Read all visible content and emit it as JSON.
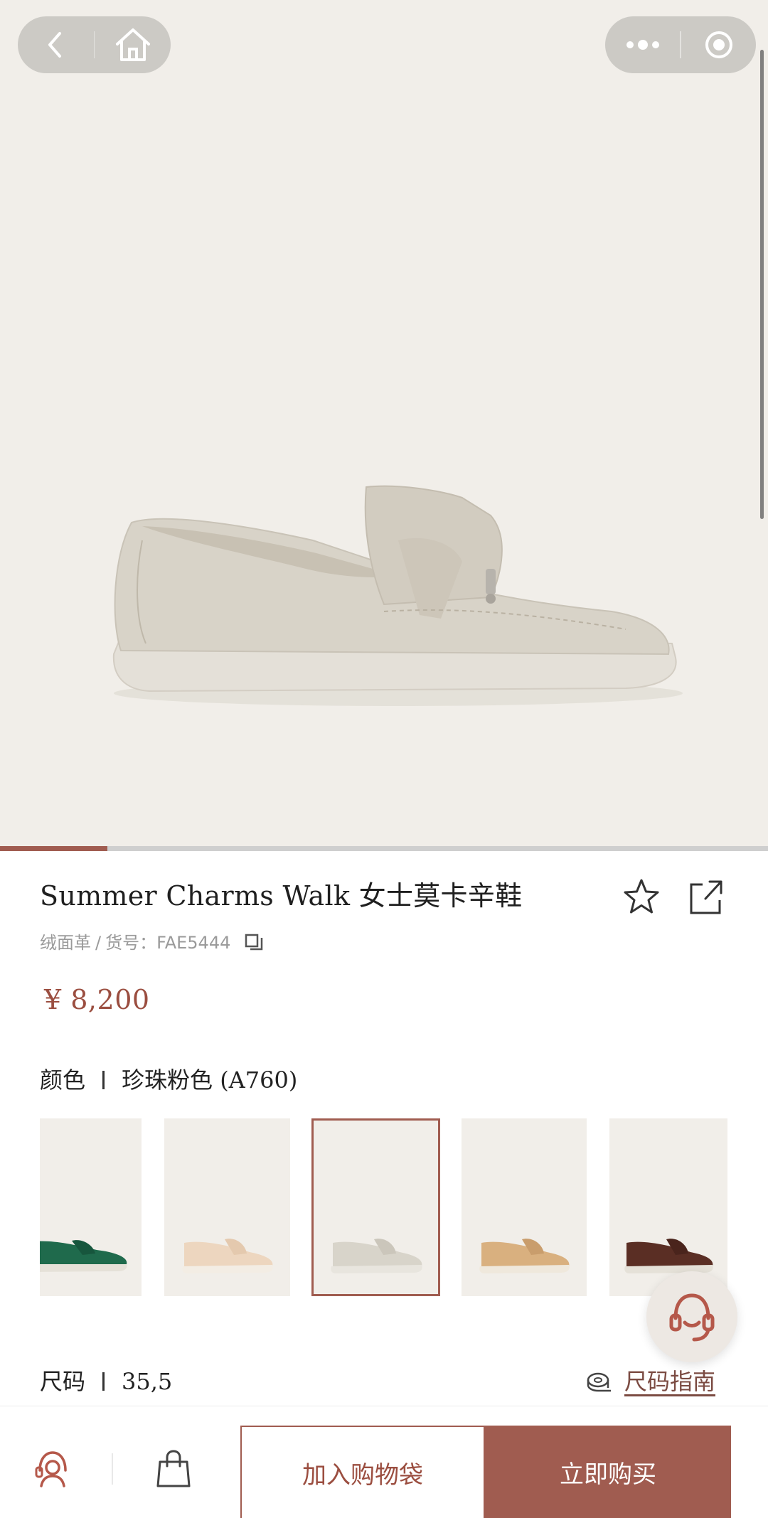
{
  "product": {
    "title": "Summer Charms Walk 女士莫卡辛鞋",
    "material": "绒面革",
    "sku_label": "货号：",
    "sku": "FAE5444",
    "price": "¥ 8,200"
  },
  "gallery": {
    "image_count_indicator": "1 / 7",
    "indicator_progress": 0.14
  },
  "color": {
    "label": "颜色",
    "value": "珍珠粉色 (A760)",
    "swatches": [
      {
        "color": "#1f6a4c",
        "selected": false
      },
      {
        "color": "#edd6bf",
        "selected": false
      },
      {
        "color": "#d8d4ca",
        "selected": true
      },
      {
        "color": "#d9b07f",
        "selected": false
      },
      {
        "color": "#5a2e24",
        "selected": false
      }
    ]
  },
  "size": {
    "label": "尺码",
    "value": "35,5",
    "guide_label": "尺码指南"
  },
  "actions": {
    "add_to_cart": "加入购物袋",
    "buy_now": "立即购买"
  },
  "colors": {
    "accent": "#a05c50",
    "background": "#f1eee9"
  }
}
